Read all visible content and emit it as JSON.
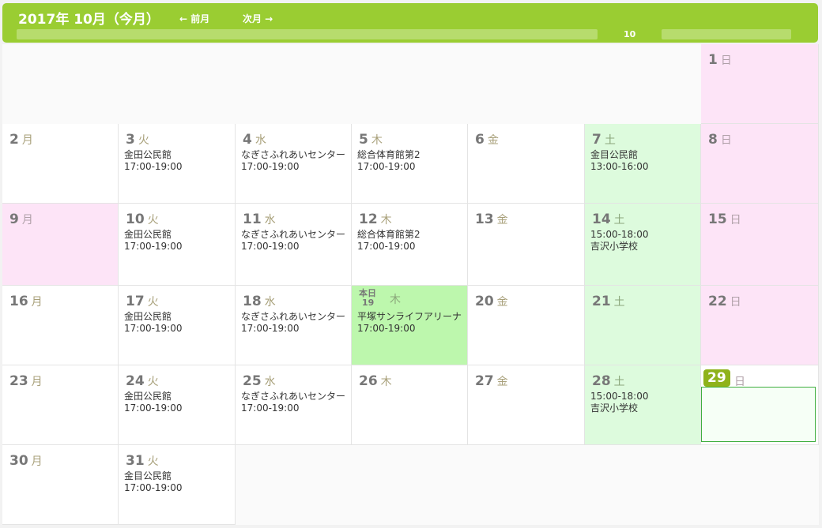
{
  "header": {
    "title": "2017年 10月（今月）",
    "prev_label": "← 前月",
    "next_label": "次月 →",
    "marker": "10"
  },
  "weeks": [
    [
      {
        "empty": true
      },
      {
        "empty": true
      },
      {
        "empty": true
      },
      {
        "empty": true
      },
      {
        "empty": true
      },
      {
        "empty": true
      },
      {
        "day": "1",
        "name": "日",
        "type": "sun",
        "lines": []
      }
    ],
    [
      {
        "day": "2",
        "name": "月",
        "type": "",
        "lines": []
      },
      {
        "day": "3",
        "name": "火",
        "type": "",
        "lines": [
          "金田公民館",
          "17:00-19:00"
        ]
      },
      {
        "day": "4",
        "name": "水",
        "type": "",
        "lines": [
          "なぎさふれあいセンター",
          "17:00-19:00"
        ]
      },
      {
        "day": "5",
        "name": "木",
        "type": "",
        "lines": [
          "総合体育館第2",
          "17:00-19:00"
        ]
      },
      {
        "day": "6",
        "name": "金",
        "type": "",
        "lines": []
      },
      {
        "day": "7",
        "name": "土",
        "type": "sat",
        "lines": [
          "金目公民館",
          "13:00-16:00"
        ]
      },
      {
        "day": "8",
        "name": "日",
        "type": "sun",
        "lines": []
      }
    ],
    [
      {
        "day": "9",
        "name": "月",
        "type": "holiday",
        "lines": []
      },
      {
        "day": "10",
        "name": "火",
        "type": "",
        "lines": [
          "金田公民館",
          "17:00-19:00"
        ]
      },
      {
        "day": "11",
        "name": "水",
        "type": "",
        "lines": [
          "なぎさふれあいセンター",
          "17:00-19:00"
        ]
      },
      {
        "day": "12",
        "name": "木",
        "type": "",
        "lines": [
          "総合体育館第2",
          "17:00-19:00"
        ]
      },
      {
        "day": "13",
        "name": "金",
        "type": "",
        "lines": []
      },
      {
        "day": "14",
        "name": "土",
        "type": "sat",
        "lines": [
          "15:00-18:00",
          "吉沢小学校"
        ]
      },
      {
        "day": "15",
        "name": "日",
        "type": "sun",
        "lines": []
      }
    ],
    [
      {
        "day": "16",
        "name": "月",
        "type": "",
        "lines": []
      },
      {
        "day": "17",
        "name": "火",
        "type": "",
        "lines": [
          "金田公民館",
          "17:00-19:00"
        ]
      },
      {
        "day": "18",
        "name": "水",
        "type": "",
        "lines": [
          "なぎさふれあいセンター",
          "17:00-19:00"
        ]
      },
      {
        "day": "19",
        "name": "木",
        "type": "today",
        "today_label": "本日",
        "lines": [
          "平塚サンライフアリーナ",
          "17:00-19:00"
        ]
      },
      {
        "day": "20",
        "name": "金",
        "type": "",
        "lines": []
      },
      {
        "day": "21",
        "name": "土",
        "type": "sat",
        "lines": []
      },
      {
        "day": "22",
        "name": "日",
        "type": "sun",
        "lines": []
      }
    ],
    [
      {
        "day": "23",
        "name": "月",
        "type": "",
        "lines": []
      },
      {
        "day": "24",
        "name": "火",
        "type": "",
        "lines": [
          "金田公民館",
          "17:00-19:00"
        ]
      },
      {
        "day": "25",
        "name": "水",
        "type": "",
        "lines": [
          "なぎさふれあいセンター",
          "17:00-19:00"
        ]
      },
      {
        "day": "26",
        "name": "木",
        "type": "",
        "lines": []
      },
      {
        "day": "27",
        "name": "金",
        "type": "",
        "lines": []
      },
      {
        "day": "28",
        "name": "土",
        "type": "sat",
        "lines": [
          "15:00-18:00",
          "吉沢小学校"
        ]
      },
      {
        "day": "29",
        "name": "日",
        "type": "selected",
        "lines": []
      }
    ],
    [
      {
        "day": "30",
        "name": "月",
        "type": "",
        "lines": []
      },
      {
        "day": "31",
        "name": "火",
        "type": "",
        "lines": [
          "金目公民館",
          "17:00-19:00"
        ]
      },
      {
        "empty": true
      },
      {
        "empty": true
      },
      {
        "empty": true
      },
      {
        "empty": true
      },
      {
        "empty": true
      }
    ]
  ]
}
